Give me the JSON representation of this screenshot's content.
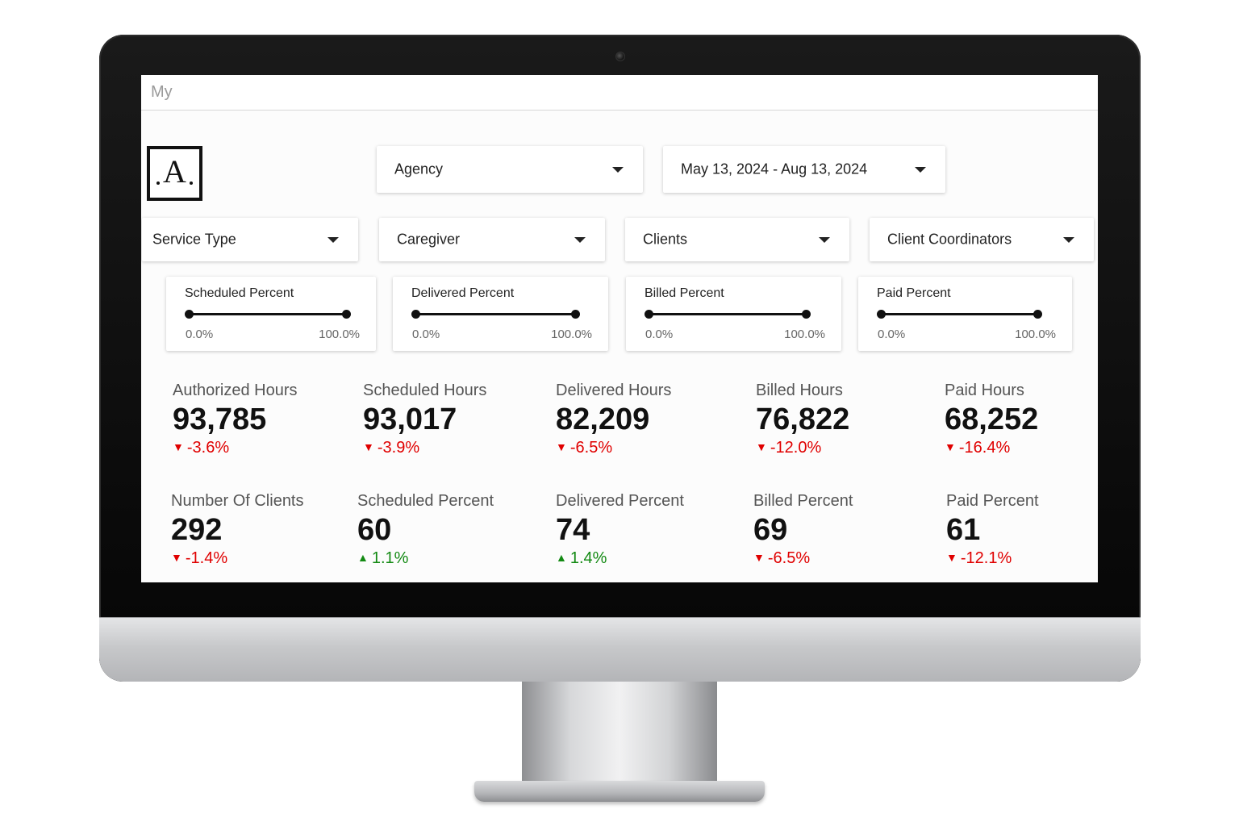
{
  "app": {
    "title": "My"
  },
  "filters": {
    "agency": "Agency",
    "date_range": "May 13, 2024 - Aug 13, 2024",
    "service_type": "Service Type",
    "caregiver": "Caregiver",
    "clients": "Clients",
    "client_coordinators": "Client Coordinators"
  },
  "sliders": [
    {
      "title": "Scheduled Percent",
      "min_label": "0.0%",
      "max_label": "100.0%",
      "min_value": 0.0,
      "max_value": 100.0
    },
    {
      "title": "Delivered Percent",
      "min_label": "0.0%",
      "max_label": "100.0%",
      "min_value": 0.0,
      "max_value": 100.0
    },
    {
      "title": "Billed Percent",
      "min_label": "0.0%",
      "max_label": "100.0%",
      "min_value": 0.0,
      "max_value": 100.0
    },
    {
      "title": "Paid Percent",
      "min_label": "0.0%",
      "max_label": "100.0%",
      "min_value": 0.0,
      "max_value": 100.0
    }
  ],
  "kpis_row1": [
    {
      "label": "Authorized Hours",
      "value": "93,785",
      "change": "-3.6%",
      "direction": "down",
      "arrow": "▼"
    },
    {
      "label": "Scheduled Hours",
      "value": "93,017",
      "change": "-3.9%",
      "direction": "down",
      "arrow": "▼"
    },
    {
      "label": "Delivered Hours",
      "value": "82,209",
      "change": "-6.5%",
      "direction": "down",
      "arrow": "▼"
    },
    {
      "label": "Billed Hours",
      "value": "76,822",
      "change": "-12.0%",
      "direction": "down",
      "arrow": "▼"
    },
    {
      "label": "Paid Hours",
      "value": "68,252",
      "change": "-16.4%",
      "direction": "down",
      "arrow": "▼"
    }
  ],
  "kpis_row2": [
    {
      "label": "Number Of Clients",
      "value": "292",
      "change": "-1.4%",
      "direction": "down",
      "arrow": "▼"
    },
    {
      "label": "Scheduled Percent",
      "value": "60",
      "change": "1.1%",
      "direction": "up",
      "arrow": "▲"
    },
    {
      "label": "Delivered Percent",
      "value": "74",
      "change": "1.4%",
      "direction": "up",
      "arrow": "▲"
    },
    {
      "label": "Billed Percent",
      "value": "69",
      "change": "-6.5%",
      "direction": "down",
      "arrow": "▼"
    },
    {
      "label": "Paid Percent",
      "value": "61",
      "change": "-12.1%",
      "direction": "down",
      "arrow": "▼"
    }
  ],
  "colors": {
    "negative": "#e00000",
    "positive": "#138a13",
    "text": "#111111"
  },
  "icons": {
    "logo": "letter-a-logo",
    "dropdown": "caret-down-icon",
    "decrease": "triangle-down-icon",
    "increase": "triangle-up-icon"
  }
}
